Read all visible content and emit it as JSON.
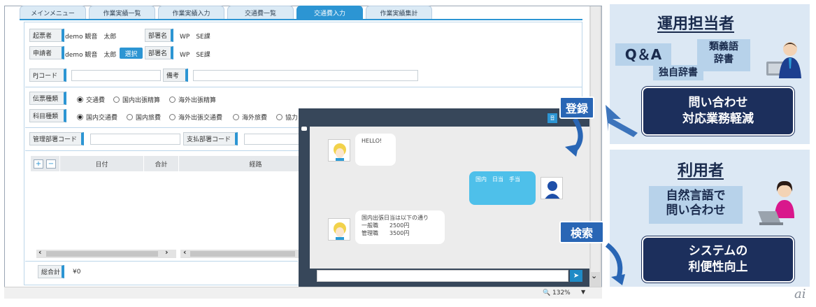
{
  "tabs": [
    "メインメニュー",
    "作業実績一覧",
    "作業実績入力",
    "交通費一覧",
    "交通費入力",
    "作業実績集計"
  ],
  "form": {
    "issuer_label": "起票者",
    "issuer_value": "demo 観音　太郎",
    "dept_label_1": "部署名",
    "dept_value_1": "WP　SE課",
    "applicant_label": "申請者",
    "applicant_value": "demo 観音　太郎",
    "select_button": "選択",
    "dept_label_2": "部署名",
    "dept_value_2": "WP　SE課",
    "pj_label": "PJコード",
    "remarks_label": "備考",
    "slip_type_label": "伝票種類",
    "slip_types": [
      "交通費",
      "国内出張精算",
      "海外出張精算"
    ],
    "account_label": "科目種類",
    "accounts": [
      "国内交通費",
      "国内旅費",
      "海外出張交通費",
      "海外旅費",
      "協力"
    ],
    "mgmt_dept_label": "管理部署コード",
    "pay_dept_label": "支払部署コード",
    "grid_add": "+",
    "grid_remove": "−",
    "grid_headers": [
      "日付",
      "合計",
      "経路"
    ],
    "total_label": "総合計",
    "total_value": "¥0",
    "zoom": "132%"
  },
  "chat": {
    "header_btn": "音",
    "messages": [
      {
        "from": "bot",
        "text": "HELLO!"
      },
      {
        "from": "user",
        "text": "国内　日当　手当"
      },
      {
        "from": "bot",
        "lines": [
          "国内出張日当は以下の通り",
          "一般職　　2500円",
          "管理職　　3500円"
        ]
      }
    ],
    "send_icon": "send-icon"
  },
  "operator_panel": {
    "title": "運用担当者",
    "tag_qa": "Q＆A",
    "tag_dict": "独自辞書",
    "tag_synonym": [
      "類義語",
      "辞書"
    ],
    "result": [
      "問い合わせ",
      "対応業務軽減"
    ]
  },
  "user_panel": {
    "title": "利用者",
    "tag_nl": [
      "自然言語で",
      "問い合わせ"
    ],
    "result": [
      "システムの",
      "利便性向上"
    ]
  },
  "callouts": {
    "register": "登録",
    "search": "検索"
  },
  "logo": "ai",
  "colors": {
    "accent": "#2c95d3",
    "navy": "#1c2f5c",
    "panel": "#dce8f4",
    "chat_frame": "#37475a",
    "user_bubble": "#4ec0ea"
  }
}
